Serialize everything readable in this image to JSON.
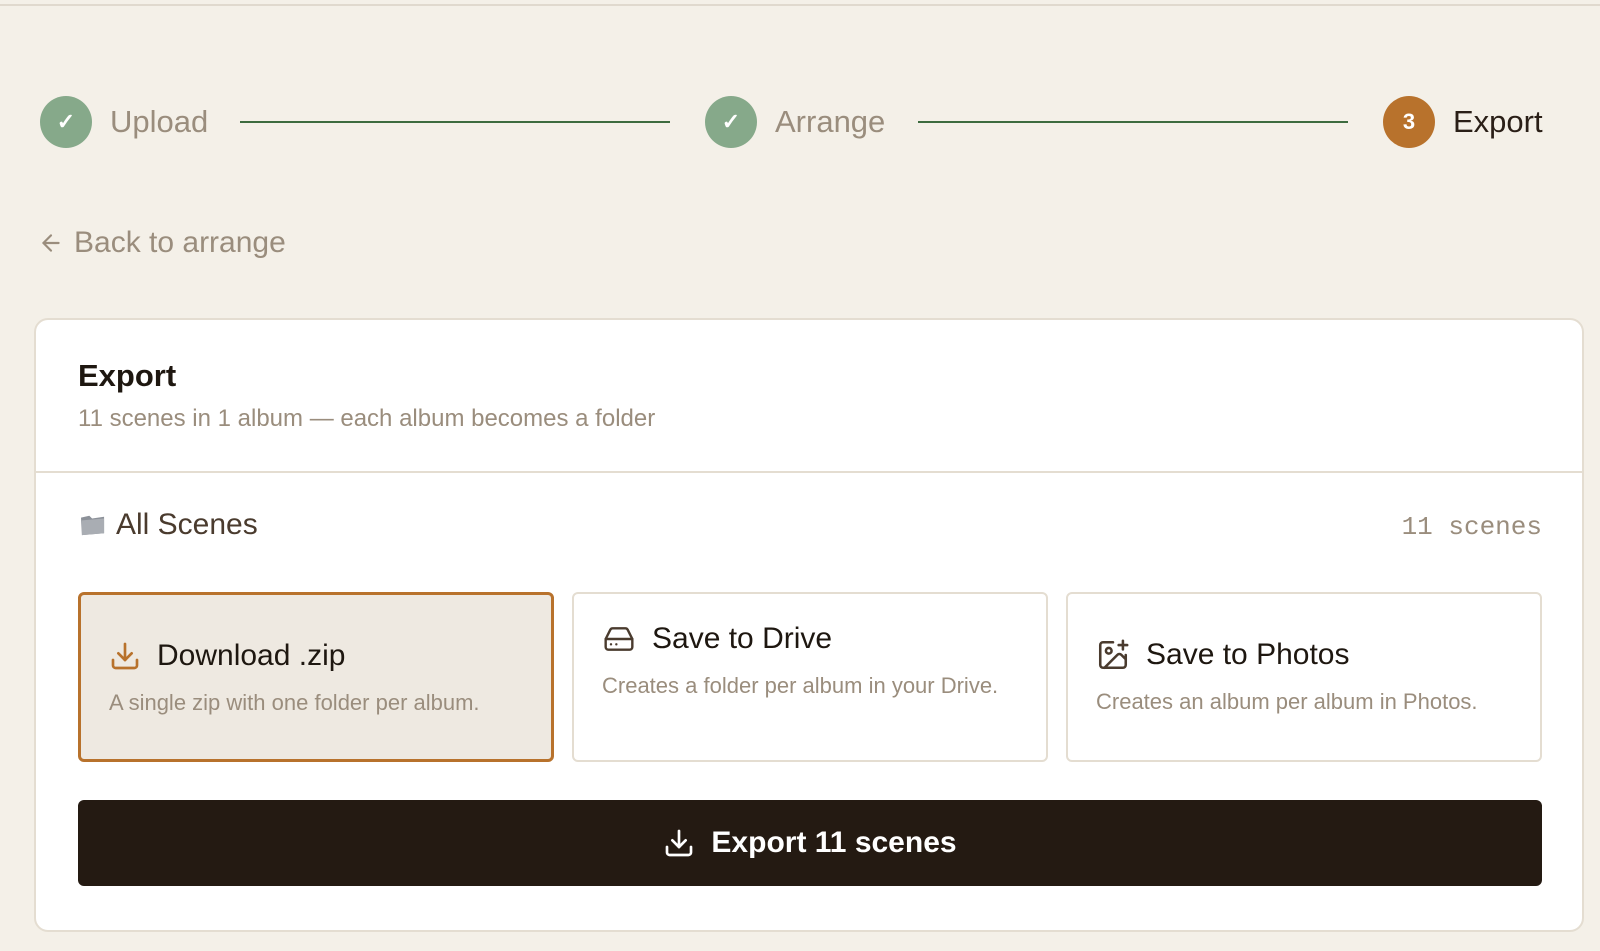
{
  "stepper": {
    "steps": [
      {
        "number": "1",
        "label": "Upload",
        "status": "done",
        "mark": "✓"
      },
      {
        "number": "2",
        "label": "Arrange",
        "status": "done",
        "mark": "✓"
      },
      {
        "number": "3",
        "label": "Export",
        "status": "current",
        "mark": "3"
      }
    ]
  },
  "back": {
    "label": "Back to arrange",
    "icon": "arrow-left-icon"
  },
  "card": {
    "title": "Export",
    "subtitle": "11 scenes in 1 album — each album becomes a folder",
    "album": {
      "name": "All Scenes",
      "icon": "folder-icon",
      "count": "11 scenes"
    },
    "options": [
      {
        "title": "Download .zip",
        "description": "A single zip with one folder per album.",
        "icon": "download-icon",
        "selected": true
      },
      {
        "title": "Save to Drive",
        "description": "Creates a folder per album in your Drive.",
        "icon": "drive-icon",
        "selected": false
      },
      {
        "title": "Save to Photos",
        "description": "Creates an album per album in Photos.",
        "icon": "image-plus-icon",
        "selected": false
      }
    ],
    "export_button": {
      "label": "Export 11 scenes",
      "icon": "download-icon"
    }
  },
  "colors": {
    "background": "#f4f0e8",
    "done": "#86a98a",
    "current": "#b8722c",
    "connector": "#3d6b3f",
    "button": "#241a12",
    "muted_text": "#9a8d7d"
  }
}
